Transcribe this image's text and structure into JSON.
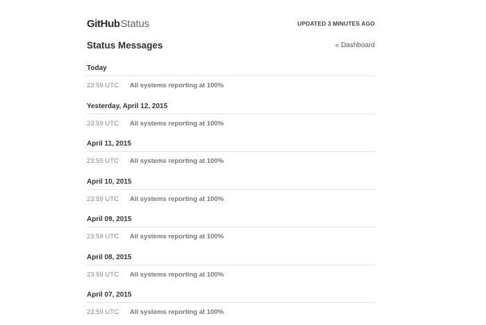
{
  "header": {
    "brand_primary": "GitHub",
    "brand_secondary": "Status",
    "updated": "UPDATED 3 MINUTES AGO"
  },
  "title": {
    "heading": "Status Messages",
    "dashboard_link": "« Dashboard"
  },
  "days": [
    {
      "label": "Today",
      "time": "23:59 UTC",
      "message": "All systems reporting at 100%"
    },
    {
      "label": "Yesterday, April 12, 2015",
      "time": "23:59 UTC",
      "message": "All systems reporting at 100%"
    },
    {
      "label": "April 11, 2015",
      "time": "23:59 UTC",
      "message": "All systems reporting at 100%"
    },
    {
      "label": "April 10, 2015",
      "time": "23:59 UTC",
      "message": "All systems reporting at 100%"
    },
    {
      "label": "April 09, 2015",
      "time": "23:59 UTC",
      "message": "All systems reporting at 100%"
    },
    {
      "label": "April 08, 2015",
      "time": "23:59 UTC",
      "message": "All systems reporting at 100%"
    },
    {
      "label": "April 07, 2015",
      "time": "23:59 UTC",
      "message": "All systems reporting at 100%"
    }
  ]
}
